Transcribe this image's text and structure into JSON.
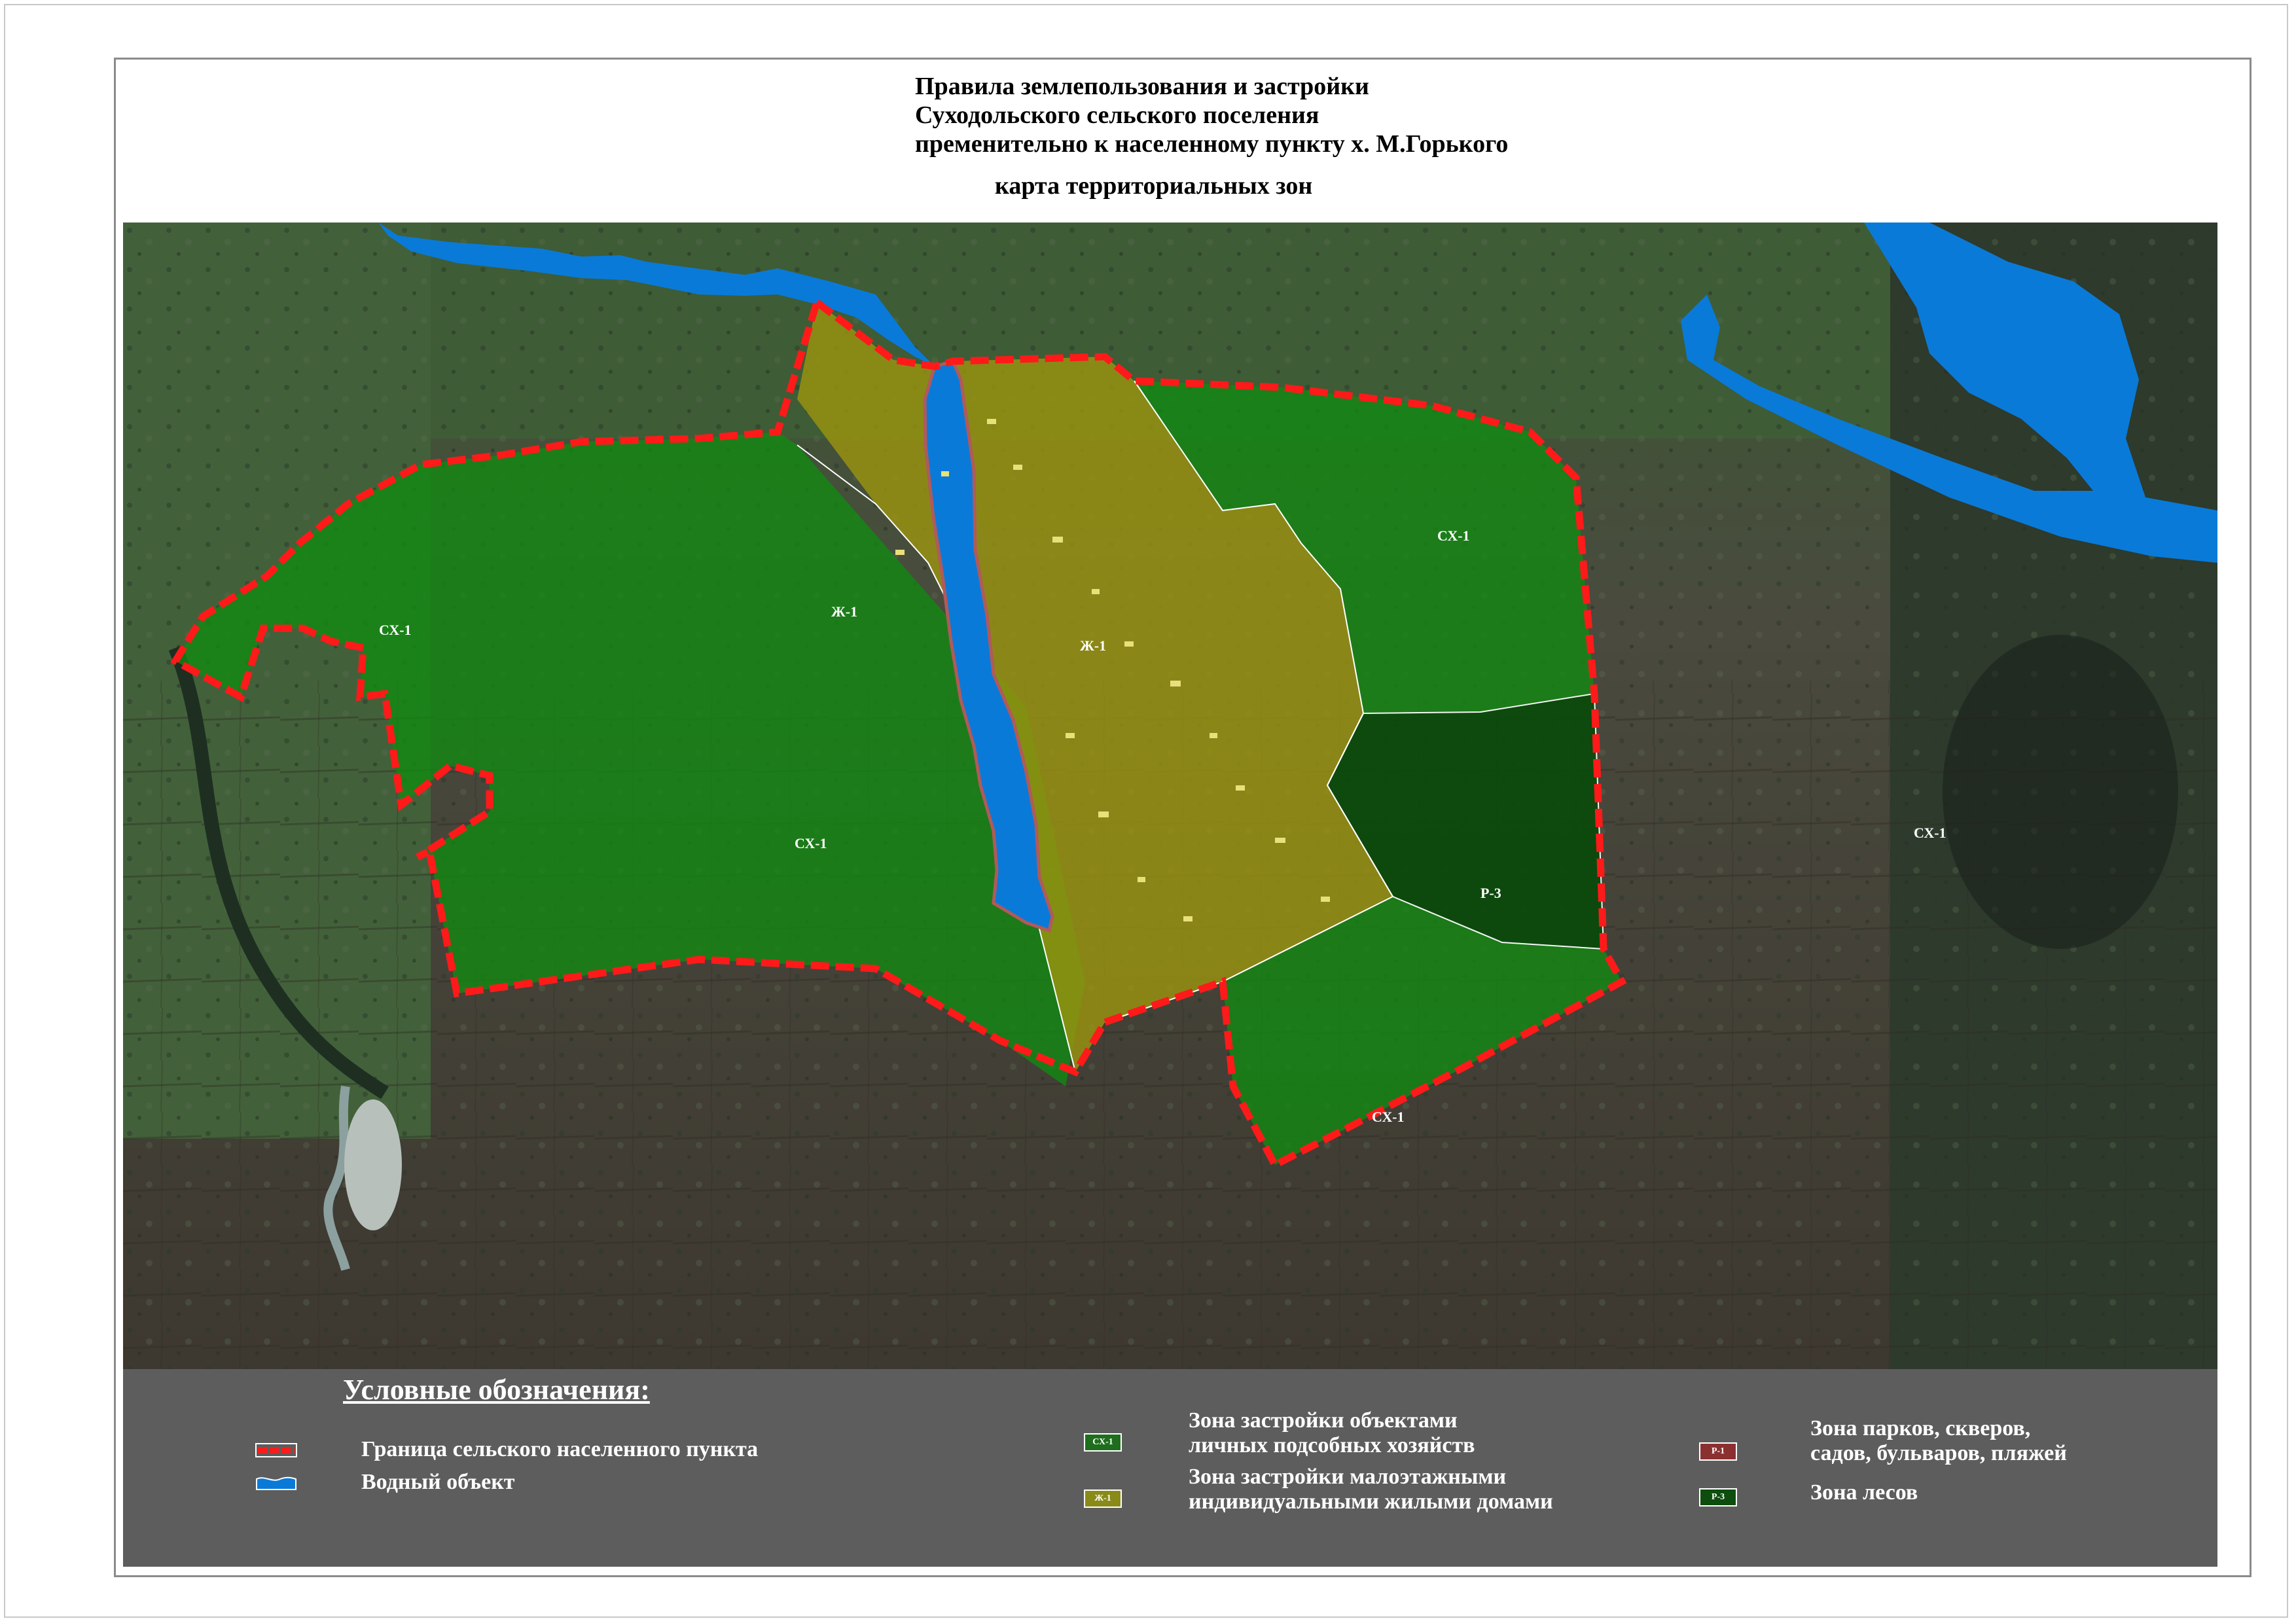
{
  "title": {
    "lines": [
      "Правила землепользования и застройки",
      "Суходольского сельского поселения",
      "пременительно к населенному пункту х. М.Горького"
    ],
    "subtitle": "карта территориальных зон"
  },
  "map": {
    "zone_labels": [
      {
        "id": "sx1-west",
        "text": "СХ-1"
      },
      {
        "id": "sx1-southwest",
        "text": "СХ-1"
      },
      {
        "id": "zh1-west",
        "text": "Ж-1"
      },
      {
        "id": "zh1-east",
        "text": "Ж-1"
      },
      {
        "id": "sx1-northeast",
        "text": "СХ-1"
      },
      {
        "id": "r3",
        "text": "Р-3"
      },
      {
        "id": "sx1-south",
        "text": "СХ-1"
      },
      {
        "id": "sx1-far-east",
        "text": "СХ-1"
      }
    ],
    "colors": {
      "sx1": "#0f6a0f",
      "zh1": "#7d7a12",
      "r3": "#0d4d0d",
      "water": "#0a7ad8",
      "boundary": "#ff1a1a"
    }
  },
  "legend": {
    "title": "Условные обозначения:",
    "items": [
      {
        "id": "boundary",
        "text": "Граница сельского населенного пункта",
        "icon": "dashed-boundary-icon"
      },
      {
        "id": "water",
        "text": "Водный объект",
        "icon": "water-wave-icon"
      },
      {
        "id": "sx1",
        "code": "СХ-1",
        "text": [
          "Зона застройки объектами",
          "личных подсобных хозяйств"
        ],
        "color": "#1e6e1e"
      },
      {
        "id": "zh1",
        "code": "Ж-1",
        "text": [
          "Зона застройки малоэтажными",
          "индивидуальными жилыми домами"
        ],
        "color": "#8a8a18"
      },
      {
        "id": "r1",
        "code": "Р-1",
        "text": [
          "Зона парков, скверов,",
          "садов, бульваров, пляжей"
        ],
        "color": "#8a3030"
      },
      {
        "id": "r3",
        "code": "Р-3",
        "text": [
          "Зона лесов"
        ],
        "color": "#0d4d0d"
      }
    ]
  }
}
